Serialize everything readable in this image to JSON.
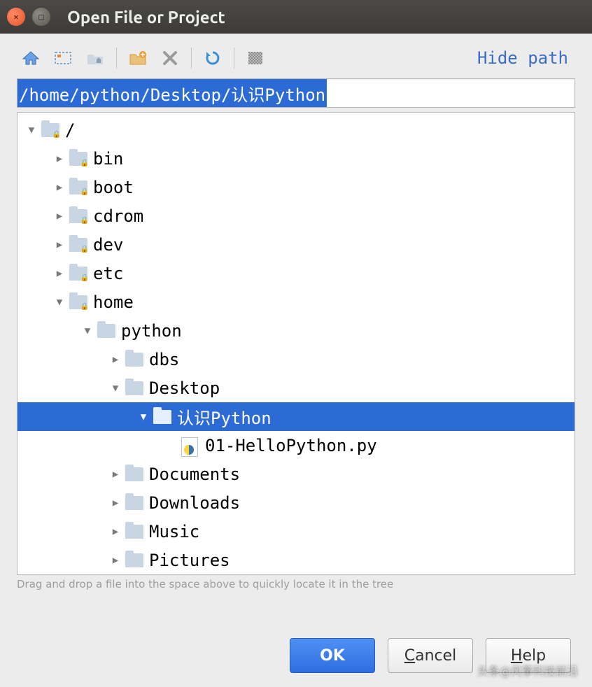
{
  "window": {
    "title": "Open File or Project"
  },
  "toolbar": {
    "icons": {
      "home": "home-icon",
      "module": "module-icon",
      "parent": "folder-up-icon",
      "newfolder": "new-folder-icon",
      "delete": "delete-icon",
      "refresh": "refresh-icon",
      "hidden": "show-hidden-icon"
    },
    "hide_path_label": "Hide path"
  },
  "path": "/home/python/Desktop/认识Python",
  "tree": [
    {
      "depth": 0,
      "state": "open",
      "kind": "folder-locked",
      "label": "/",
      "selected": false
    },
    {
      "depth": 1,
      "state": "closed",
      "kind": "folder-locked",
      "label": "bin",
      "selected": false
    },
    {
      "depth": 1,
      "state": "closed",
      "kind": "folder-locked",
      "label": "boot",
      "selected": false
    },
    {
      "depth": 1,
      "state": "closed",
      "kind": "folder-locked",
      "label": "cdrom",
      "selected": false
    },
    {
      "depth": 1,
      "state": "closed",
      "kind": "folder-locked",
      "label": "dev",
      "selected": false
    },
    {
      "depth": 1,
      "state": "closed",
      "kind": "folder-locked",
      "label": "etc",
      "selected": false
    },
    {
      "depth": 1,
      "state": "open",
      "kind": "folder-locked",
      "label": "home",
      "selected": false
    },
    {
      "depth": 2,
      "state": "open",
      "kind": "folder",
      "label": "python",
      "selected": false
    },
    {
      "depth": 3,
      "state": "closed",
      "kind": "folder",
      "label": "dbs",
      "selected": false
    },
    {
      "depth": 3,
      "state": "open",
      "kind": "folder",
      "label": "Desktop",
      "selected": false
    },
    {
      "depth": 4,
      "state": "open",
      "kind": "folder",
      "label": "认识Python",
      "selected": true
    },
    {
      "depth": 5,
      "state": "none",
      "kind": "pyfile",
      "label": "01-HelloPython.py",
      "selected": false
    },
    {
      "depth": 3,
      "state": "closed",
      "kind": "folder",
      "label": "Documents",
      "selected": false
    },
    {
      "depth": 3,
      "state": "closed",
      "kind": "folder",
      "label": "Downloads",
      "selected": false
    },
    {
      "depth": 3,
      "state": "closed",
      "kind": "folder",
      "label": "Music",
      "selected": false
    },
    {
      "depth": 3,
      "state": "closed",
      "kind": "folder",
      "label": "Pictures",
      "selected": false
    }
  ],
  "hint": "Drag and drop a file into the space above to quickly locate it in the tree",
  "buttons": {
    "ok": "OK",
    "cancel": "Cancel",
    "help": "Help"
  },
  "watermark": "头条@风筝科技前沿"
}
